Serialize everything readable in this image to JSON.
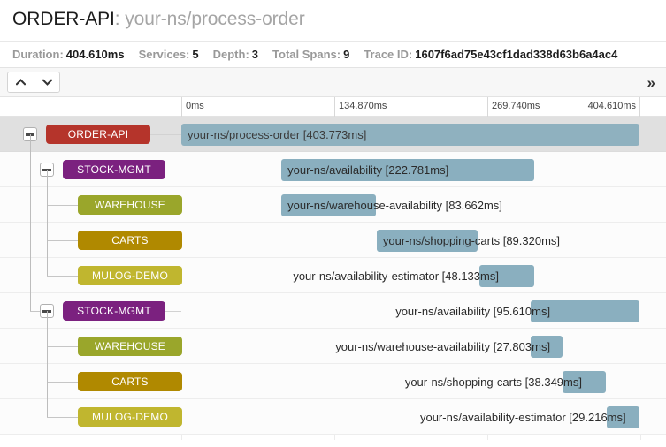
{
  "header": {
    "service": "ORDER-API",
    "separator": ":",
    "operation": "your-ns/process-order"
  },
  "summary": [
    {
      "label": "Duration:",
      "value": "404.610ms"
    },
    {
      "label": "Services:",
      "value": "5"
    },
    {
      "label": "Depth:",
      "value": "3"
    },
    {
      "label": "Total Spans:",
      "value": "9"
    },
    {
      "label": "Trace ID:",
      "value": "1607f6ad75e43cf1dad338d63b6a4ac4"
    }
  ],
  "toolbar": {
    "prev_label": "∧",
    "next_label": "∨",
    "expand_label": "»"
  },
  "timeline": {
    "start_ms": 0,
    "end_ms": 404.61,
    "ticks": [
      {
        "label": "0ms",
        "ms": 0
      },
      {
        "label": "134.870ms",
        "ms": 134.87
      },
      {
        "label": "269.740ms",
        "ms": 269.74
      },
      {
        "label": "404.610ms",
        "ms": 404.61
      }
    ]
  },
  "services": {
    "order-api": {
      "name": "ORDER-API",
      "color": "#b5342b"
    },
    "stock-mgmt": {
      "name": "STOCK-MGMT",
      "color": "#7b217f"
    },
    "warehouse": {
      "name": "WAREHOUSE",
      "color": "#9aa62b"
    },
    "carts": {
      "name": "CARTS",
      "color": "#b08900"
    },
    "mulog-demo": {
      "name": "MULOG-DEMO",
      "color": "#c0b62f"
    }
  },
  "spans": [
    {
      "service": "ORDER-API",
      "color": "#b5342b",
      "operation": "your-ns/process-order",
      "duration": "403.773ms",
      "label": "your-ns/process-order [403.773ms]",
      "start_ms": 0.0,
      "duration_ms": 403.773,
      "depth": 0,
      "has_toggle": true,
      "label_position": "inside",
      "selected": true
    },
    {
      "service": "STOCK-MGMT",
      "color": "#7b217f",
      "operation": "your-ns/availability",
      "duration": "222.781ms",
      "label": "your-ns/availability [222.781ms]",
      "start_ms": 88.2,
      "duration_ms": 222.781,
      "depth": 1,
      "has_toggle": true,
      "label_position": "inside",
      "selected": false
    },
    {
      "service": "WAREHOUSE",
      "color": "#9aa62b",
      "operation": "your-ns/warehouse-availability",
      "duration": "83.662ms",
      "label": "your-ns/warehouse-availability [83.662ms]",
      "start_ms": 88.2,
      "duration_ms": 83.662,
      "depth": 2,
      "has_toggle": false,
      "label_position": "inside",
      "selected": false
    },
    {
      "service": "CARTS",
      "color": "#b08900",
      "operation": "your-ns/shopping-carts",
      "duration": "89.320ms",
      "label": "your-ns/shopping-carts [89.320ms]",
      "start_ms": 172.2,
      "duration_ms": 89.32,
      "depth": 2,
      "has_toggle": false,
      "label_position": "inside",
      "selected": false
    },
    {
      "service": "MULOG-DEMO",
      "color": "#c0b62f",
      "operation": "your-ns/availability-estimator",
      "duration": "48.133ms",
      "label": "your-ns/availability-estimator [48.133ms]",
      "start_ms": 262.7,
      "duration_ms": 48.133,
      "depth": 2,
      "has_toggle": false,
      "label_position": "outside",
      "selected": false
    },
    {
      "service": "STOCK-MGMT",
      "color": "#7b217f",
      "operation": "your-ns/availability",
      "duration": "95.610ms",
      "label": "your-ns/availability [95.610ms]",
      "start_ms": 308.0,
      "duration_ms": 95.61,
      "depth": 1,
      "has_toggle": true,
      "label_position": "outside",
      "selected": false
    },
    {
      "service": "WAREHOUSE",
      "color": "#9aa62b",
      "operation": "your-ns/warehouse-availability",
      "duration": "27.803ms",
      "label": "your-ns/warehouse-availability [27.803ms]",
      "start_ms": 308.0,
      "duration_ms": 27.803,
      "depth": 2,
      "has_toggle": false,
      "label_position": "outside",
      "selected": false
    },
    {
      "service": "CARTS",
      "color": "#b08900",
      "operation": "your-ns/shopping-carts",
      "duration": "38.349ms",
      "label": "your-ns/shopping-carts [38.349ms]",
      "start_ms": 336.0,
      "duration_ms": 38.349,
      "depth": 2,
      "has_toggle": false,
      "label_position": "outside",
      "selected": false
    },
    {
      "service": "MULOG-DEMO",
      "color": "#c0b62f",
      "operation": "your-ns/availability-estimator",
      "duration": "29.216ms",
      "label": "your-ns/availability-estimator [29.216ms]",
      "start_ms": 374.7,
      "duration_ms": 29.216,
      "depth": 2,
      "has_toggle": false,
      "label_position": "outside",
      "selected": false
    }
  ]
}
